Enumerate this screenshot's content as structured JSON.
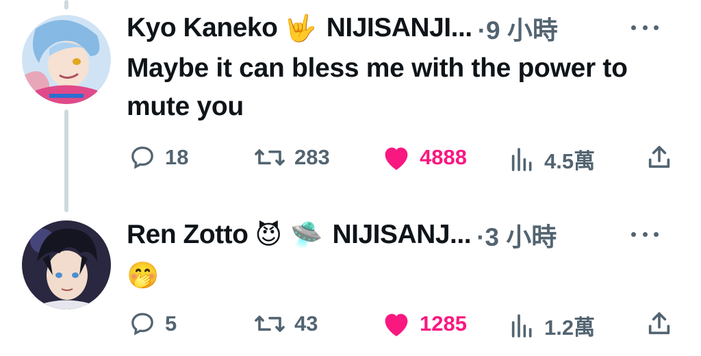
{
  "tweets": [
    {
      "name": "Kyo Kaneko",
      "name_emoji": "🤟",
      "org": "NIJISANJI...",
      "time": "·9 小時",
      "text": "Maybe it can bless me with the power to mute you",
      "replies": "18",
      "retweets": "283",
      "likes": "4888",
      "views": "4.5萬",
      "liked": true
    },
    {
      "name": "Ren Zotto",
      "name_emoji": "😈 🛸",
      "org": "NIJISANJ...",
      "time": "·3 小時",
      "text": "🤭",
      "replies": "5",
      "retweets": "43",
      "likes": "1285",
      "views": "1.2萬",
      "liked": true
    }
  ],
  "colors": {
    "like": "#f91880",
    "meta": "#536471",
    "thread_line": "#cfd9de"
  },
  "icons": [
    "reply-icon",
    "retweet-icon",
    "like-heart-icon",
    "views-icon",
    "share-icon",
    "more-icon"
  ]
}
